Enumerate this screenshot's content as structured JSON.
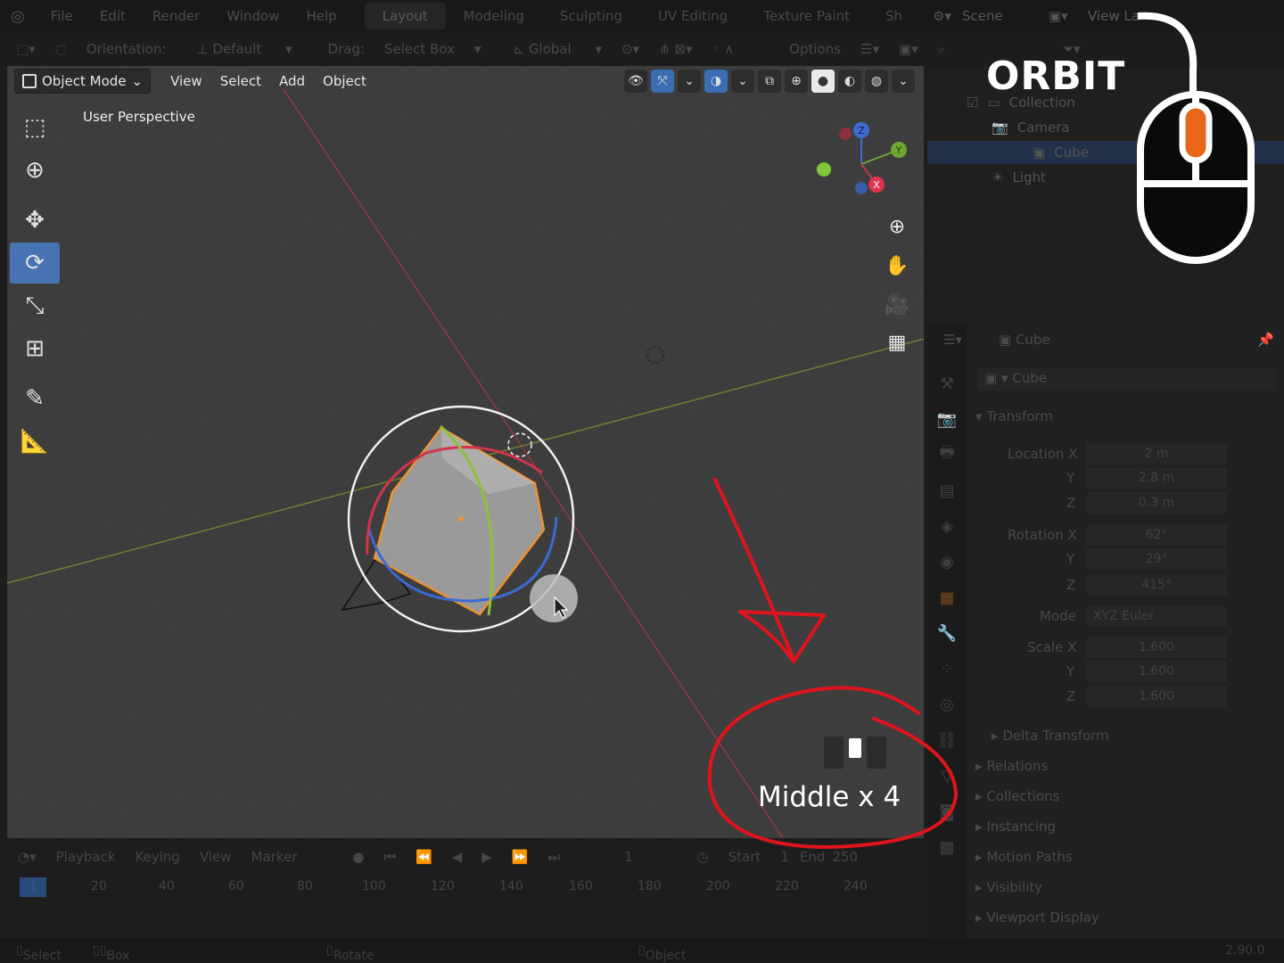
{
  "topbar": {
    "menus": [
      "File",
      "Edit",
      "Render",
      "Window",
      "Help"
    ],
    "workspaces": [
      "Layout",
      "Modeling",
      "Sculpting",
      "UV Editing",
      "Texture Paint",
      "Sh"
    ],
    "scene": "Scene",
    "view_layer": "View La"
  },
  "toolheader": {
    "orientation_label": "Orientation:",
    "orientation_value": "Default",
    "drag_label": "Drag:",
    "drag_value": "Select Box",
    "transform": "Global",
    "options": "Options"
  },
  "viewport": {
    "mode": "Object Mode",
    "menus": [
      "View",
      "Select",
      "Add",
      "Object"
    ],
    "perspective_label": "User Perspective",
    "gizmo_axes": [
      "Z",
      "Y",
      "X"
    ]
  },
  "outliner": {
    "items": [
      "Collection",
      "Camera",
      "Cube",
      "Light"
    ]
  },
  "properties": {
    "object_name": "Cube",
    "data_name": "Cube",
    "transform_panel": "Transform",
    "location": {
      "label": "Location X",
      "x": "2 m",
      "y": "2.8 m",
      "z": "0.3 m"
    },
    "rotation": {
      "label": "Rotation X",
      "x": "62°",
      "y": "29°",
      "z": "415°"
    },
    "mode_label": "Mode",
    "mode_value": "XYZ Euler",
    "scale": {
      "label": "Scale X",
      "x": "1.600",
      "y": "1.600",
      "z": "1.600"
    },
    "axis_y": "Y",
    "axis_z": "Z",
    "sections": [
      "Delta Transform",
      "Relations",
      "Collections",
      "Instancing",
      "Motion Paths",
      "Visibility",
      "Viewport Display"
    ]
  },
  "timeline": {
    "menus": [
      "Playback",
      "Keying",
      "View",
      "Marker"
    ],
    "current_frame": "1",
    "start_label": "Start",
    "start_value": "1",
    "end_label": "End",
    "end_value": "250",
    "ruler": [
      "1",
      "20",
      "40",
      "60",
      "80",
      "100",
      "120",
      "140",
      "160",
      "180",
      "200",
      "220",
      "240"
    ]
  },
  "statusbar": {
    "select": "Select",
    "box_select": "Box Select",
    "rotate_view": "Rotate View",
    "context_menu": "Object Context Menu",
    "version": "2.90.0"
  },
  "overlay": {
    "title": "ORBIT",
    "key_label": "Middle x 4",
    "accent_orange": "#e8651a",
    "annotation_red": "#e0141e"
  }
}
